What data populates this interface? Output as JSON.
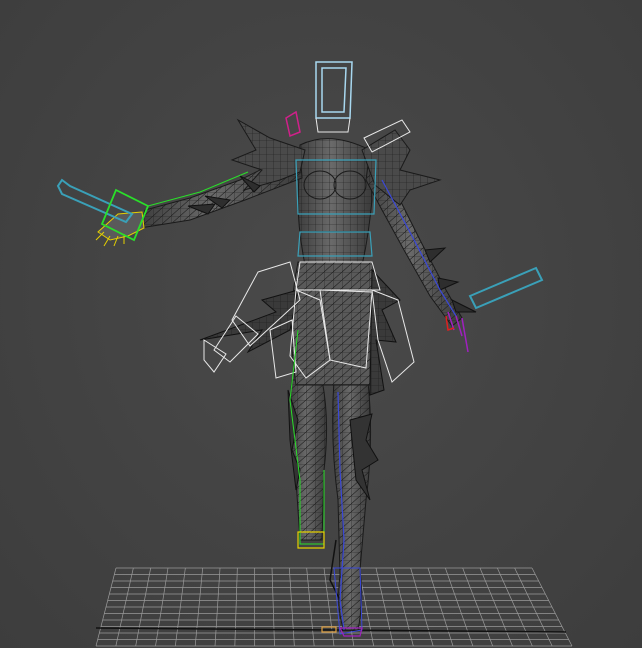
{
  "viewport": {
    "background": "#444444",
    "mode": "wireframe-on-shaded"
  },
  "colors": {
    "grid": "#9a9a9a",
    "grid_axis": "#111111",
    "mesh_fill": "#595959",
    "mesh_wire": "#1a1a1a",
    "bone_cyan": "#3aa0b8",
    "bone_white": "#e8e8e8",
    "selection_green": "#2adf2a",
    "hand_yellow": "#e5d000",
    "spine_blue": "#3a48d8",
    "head_box": "#a8d8f0",
    "finger_red": "#e02020",
    "finger_purple": "#a020c0",
    "magenta": "#d0208a",
    "pivot_orange": "#e0a040"
  },
  "scene": {
    "object": "character-rig",
    "gizmos": [
      "head-bone-box",
      "left-hand-bone-box",
      "left-forearm-bone",
      "right-forearm-bone",
      "skirt-bones",
      "spine-bones",
      "leg-bones"
    ]
  }
}
